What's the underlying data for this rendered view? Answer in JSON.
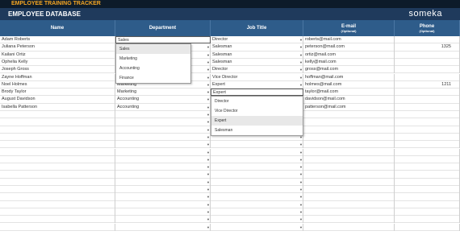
{
  "app": {
    "tracker_title": "EMPLOYEE TRAINING TRACKER",
    "page_title": "EMPLOYEE DATABASE",
    "brand": "someka"
  },
  "columns": [
    {
      "label": "Name",
      "sub": ""
    },
    {
      "label": "Department",
      "sub": ""
    },
    {
      "label": "Job Title",
      "sub": ""
    },
    {
      "label": "E-mail",
      "sub": "(Optional)"
    },
    {
      "label": "Phone",
      "sub": "(Optional)"
    }
  ],
  "rows": [
    {
      "name": "Adam Roberts",
      "department": "",
      "job": "Director",
      "email": "roberts@mail.com",
      "phone": ""
    },
    {
      "name": "Juliana Peterson",
      "department": "",
      "job": "Salesman",
      "email": "peterson@mail.com",
      "phone": "1325"
    },
    {
      "name": "Kailani Ortiz",
      "department": "",
      "job": "Salesman",
      "email": "ortiz@mail.com",
      "phone": ""
    },
    {
      "name": "Ophelia Kelly",
      "department": "",
      "job": "Salesman",
      "email": "kelly@mail.com",
      "phone": ""
    },
    {
      "name": "Joseph Gross",
      "department": "",
      "job": "Director",
      "email": "gross@mail.com",
      "phone": ""
    },
    {
      "name": "Zayne Hoffman",
      "department": "",
      "job": "Vice Director",
      "email": "hoffman@mail.com",
      "phone": ""
    },
    {
      "name": "Noel Holmes",
      "department": "Marketing",
      "job": "Expert",
      "email": "holmes@mail.com",
      "phone": "1211"
    },
    {
      "name": "Brody Taylor",
      "department": "Marketing",
      "job": "Expert",
      "email": "taylor@mail.com",
      "phone": ""
    },
    {
      "name": "August Davidson",
      "department": "Accounting",
      "job": "",
      "email": "davidson@mail.com",
      "phone": ""
    },
    {
      "name": "Isabella Patterson",
      "department": "Accounting",
      "job": "",
      "email": "patterson@mail.com",
      "phone": ""
    }
  ],
  "department_dropdown": {
    "value": "Sales",
    "options": [
      "Sales",
      "Marketing",
      "Accounting",
      "Finance"
    ]
  },
  "job_dropdown": {
    "value": "Expert",
    "options": [
      "Director",
      "Vice Director",
      "Expert",
      "Salesman"
    ]
  }
}
